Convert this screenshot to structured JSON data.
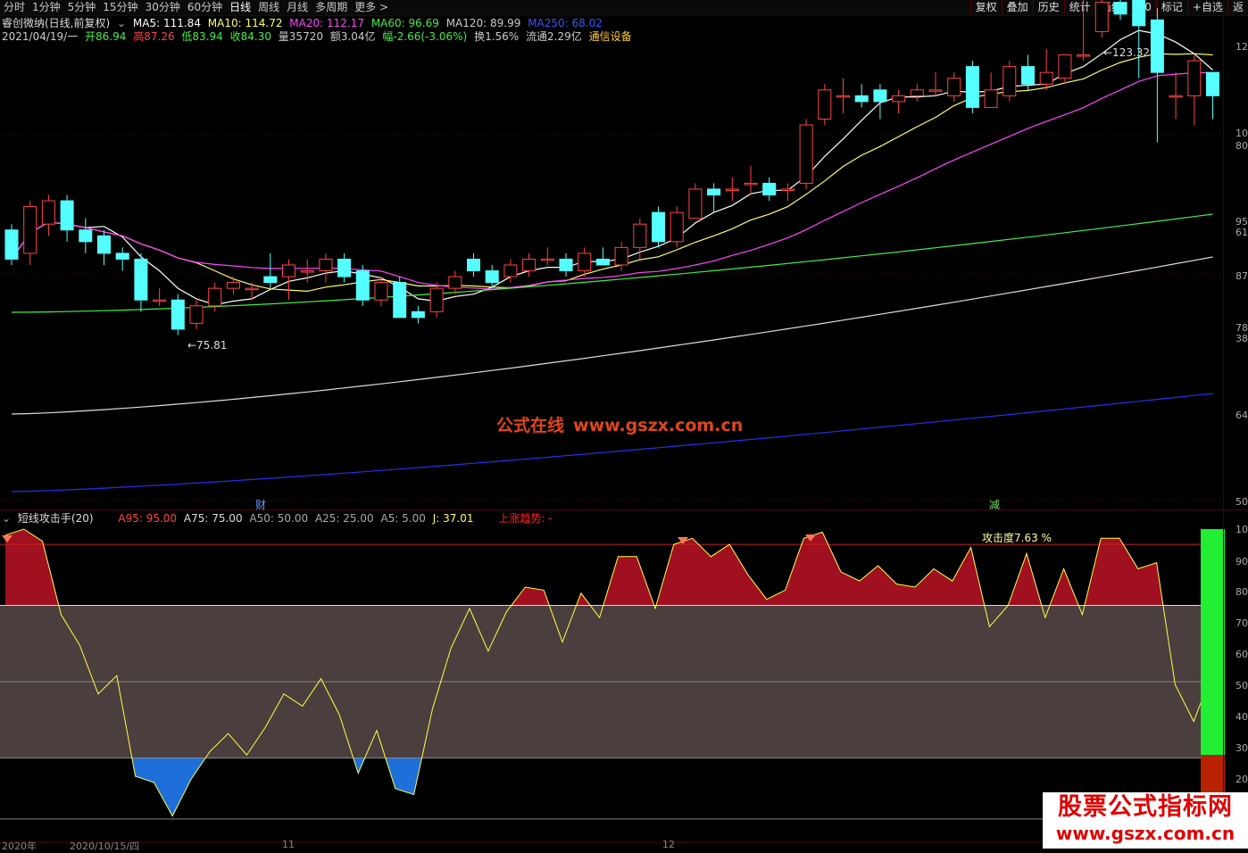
{
  "toolbar": {
    "periods": [
      "分时",
      "1分钟",
      "5分钟",
      "15分钟",
      "30分钟",
      "60分钟",
      "日线",
      "周线",
      "月线",
      "多周期",
      "更多 >"
    ],
    "right": [
      "复权",
      "叠加",
      "历史",
      "统计",
      "画线",
      "F10",
      "标记",
      "+自选",
      "返"
    ]
  },
  "ma_row": {
    "stock": "睿创微纳(日线,前复权)",
    "items": [
      {
        "text": "MA5: 111.84",
        "color": "#ffffff"
      },
      {
        "text": "MA10: 114.72",
        "color": "#ffff66"
      },
      {
        "text": "MA20: 112.17",
        "color": "#ff44ff"
      },
      {
        "text": "MA60: 96.69",
        "color": "#44ee44"
      },
      {
        "text": "MA120: 89.99",
        "color": "#cccccc"
      },
      {
        "text": "MA250: 68.02",
        "color": "#3355ff"
      }
    ]
  },
  "quote_row": {
    "items": [
      {
        "text": "2021/04/19/一",
        "color": "#cccccc"
      },
      {
        "text": "开86.94",
        "color": "#44ee44"
      },
      {
        "text": "高87.26",
        "color": "#ff4444"
      },
      {
        "text": "低83.94",
        "color": "#44ee44"
      },
      {
        "text": "收84.30",
        "color": "#44ee44"
      },
      {
        "text": "量35720",
        "color": "#cccccc"
      },
      {
        "text": "额3.04亿",
        "color": "#cccccc"
      },
      {
        "text": "幅-2.66(-3.06%)",
        "color": "#44ee44"
      },
      {
        "text": "换1.56%",
        "color": "#cccccc"
      },
      {
        "text": "流通2.29亿",
        "color": "#cccccc"
      },
      {
        "text": "通信设备",
        "color": "#ffcc33"
      }
    ]
  },
  "price_chart": {
    "high_label": "←123.32",
    "low_label": "←75.81",
    "markers": [
      "财",
      "减"
    ],
    "right_ticks": [
      "12",
      "10",
      "80",
      "95",
      "61",
      "87",
      "78",
      "38",
      "64",
      "50"
    ],
    "candles": [
      {
        "o": 94,
        "c": 89,
        "h": 95,
        "l": 88
      },
      {
        "o": 90,
        "c": 98,
        "h": 99,
        "l": 88
      },
      {
        "o": 95,
        "c": 99,
        "h": 100,
        "l": 93
      },
      {
        "o": 99,
        "c": 94,
        "h": 100,
        "l": 92
      },
      {
        "o": 94,
        "c": 92,
        "h": 96,
        "l": 90
      },
      {
        "o": 93,
        "c": 90,
        "h": 94,
        "l": 88
      },
      {
        "o": 90,
        "c": 89,
        "h": 91,
        "l": 87
      },
      {
        "o": 89,
        "c": 82,
        "h": 90,
        "l": 80
      },
      {
        "o": 82,
        "c": 82,
        "h": 84,
        "l": 81
      },
      {
        "o": 82,
        "c": 77,
        "h": 83,
        "l": 76
      },
      {
        "o": 78,
        "c": 81,
        "h": 82,
        "l": 77
      },
      {
        "o": 81,
        "c": 84,
        "h": 85,
        "l": 80
      },
      {
        "o": 84,
        "c": 85,
        "h": 86,
        "l": 83
      },
      {
        "o": 84,
        "c": 84,
        "h": 85,
        "l": 82
      },
      {
        "o": 86,
        "c": 85,
        "h": 90,
        "l": 84
      },
      {
        "o": 86,
        "c": 88,
        "h": 89,
        "l": 82
      },
      {
        "o": 87,
        "c": 87,
        "h": 89,
        "l": 85
      },
      {
        "o": 87,
        "c": 89,
        "h": 90,
        "l": 85
      },
      {
        "o": 89,
        "c": 86,
        "h": 90,
        "l": 85
      },
      {
        "o": 87,
        "c": 82,
        "h": 88,
        "l": 81
      },
      {
        "o": 82,
        "c": 85,
        "h": 86,
        "l": 81
      },
      {
        "o": 85,
        "c": 79,
        "h": 86,
        "l": 79
      },
      {
        "o": 80,
        "c": 79,
        "h": 81,
        "l": 78
      },
      {
        "o": 80,
        "c": 84,
        "h": 85,
        "l": 79
      },
      {
        "o": 84,
        "c": 86,
        "h": 87,
        "l": 83
      },
      {
        "o": 89,
        "c": 87,
        "h": 90,
        "l": 86
      },
      {
        "o": 87,
        "c": 85,
        "h": 88,
        "l": 84
      },
      {
        "o": 86,
        "c": 88,
        "h": 89,
        "l": 85
      },
      {
        "o": 87,
        "c": 89,
        "h": 90,
        "l": 86
      },
      {
        "o": 89,
        "c": 89,
        "h": 91,
        "l": 88
      },
      {
        "o": 89,
        "c": 87,
        "h": 90,
        "l": 86
      },
      {
        "o": 87,
        "c": 90,
        "h": 91,
        "l": 86
      },
      {
        "o": 89,
        "c": 88,
        "h": 91,
        "l": 88
      },
      {
        "o": 88,
        "c": 91,
        "h": 92,
        "l": 87
      },
      {
        "o": 91,
        "c": 95,
        "h": 96,
        "l": 89
      },
      {
        "o": 97,
        "c": 92,
        "h": 98,
        "l": 91
      },
      {
        "o": 92,
        "c": 97,
        "h": 98,
        "l": 91
      },
      {
        "o": 96,
        "c": 101,
        "h": 102,
        "l": 96
      },
      {
        "o": 101,
        "c": 100,
        "h": 102,
        "l": 97
      },
      {
        "o": 101,
        "c": 101,
        "h": 103,
        "l": 99
      },
      {
        "o": 102,
        "c": 102,
        "h": 105,
        "l": 100
      },
      {
        "o": 102,
        "c": 100,
        "h": 103,
        "l": 99
      },
      {
        "o": 101,
        "c": 101,
        "h": 102,
        "l": 99
      },
      {
        "o": 102,
        "c": 112,
        "h": 113,
        "l": 101
      },
      {
        "o": 113,
        "c": 118,
        "h": 119,
        "l": 112
      },
      {
        "o": 117,
        "c": 117,
        "h": 120,
        "l": 114
      },
      {
        "o": 117,
        "c": 116,
        "h": 119,
        "l": 115
      },
      {
        "o": 118,
        "c": 116,
        "h": 119,
        "l": 113
      },
      {
        "o": 116,
        "c": 117,
        "h": 118,
        "l": 114
      },
      {
        "o": 117,
        "c": 118,
        "h": 119,
        "l": 116
      },
      {
        "o": 118,
        "c": 118,
        "h": 121,
        "l": 117
      },
      {
        "o": 117,
        "c": 120,
        "h": 121,
        "l": 116
      },
      {
        "o": 122,
        "c": 115,
        "h": 123,
        "l": 114
      },
      {
        "o": 115,
        "c": 118,
        "h": 121,
        "l": 116
      },
      {
        "o": 117,
        "c": 122,
        "h": 123,
        "l": 116
      },
      {
        "o": 122,
        "c": 119,
        "h": 124,
        "l": 118
      },
      {
        "o": 119,
        "c": 121,
        "h": 125,
        "l": 118
      },
      {
        "o": 120,
        "c": 124,
        "h": 124,
        "l": 119
      },
      {
        "o": 124,
        "c": 124,
        "h": 135,
        "l": 123
      },
      {
        "o": 128,
        "c": 133,
        "h": 134,
        "l": 127
      },
      {
        "o": 133,
        "c": 131,
        "h": 136,
        "l": 130
      },
      {
        "o": 134,
        "c": 129,
        "h": 134,
        "l": 120
      },
      {
        "o": 130,
        "c": 121,
        "h": 132,
        "l": 109
      },
      {
        "o": 117,
        "c": 117,
        "h": 121,
        "l": 113
      },
      {
        "o": 117,
        "c": 123,
        "h": 124,
        "l": 112
      },
      {
        "o": 121,
        "c": 117,
        "h": 121,
        "l": 113
      }
    ]
  },
  "indicator": {
    "name": "短线攻击手(20)",
    "values": [
      {
        "text": "A95: 95.00",
        "color": "#ff4444"
      },
      {
        "text": "A75: 75.00",
        "color": "#dddddd"
      },
      {
        "text": "A50: 50.00",
        "color": "#aaaaaa"
      },
      {
        "text": "A25: 25.00",
        "color": "#aaaaaa"
      },
      {
        "text": "A5: 5.00",
        "color": "#aaaaaa"
      },
      {
        "text": "J: 37.01",
        "color": "#ffff66"
      },
      {
        "text": "上涨趋势: -",
        "color": "#ff2222"
      }
    ],
    "attack_label": "攻击度7.63 %",
    "levels": [
      95,
      75,
      50,
      25,
      5
    ],
    "right_ticks": [
      "10",
      "90",
      "80",
      "70",
      "60",
      "50",
      "40",
      "30",
      "20"
    ],
    "j": [
      98,
      100,
      96,
      72,
      62,
      46,
      52,
      19,
      17,
      6,
      18,
      27,
      33,
      26,
      35,
      46,
      42,
      51,
      39,
      20,
      34,
      15,
      13,
      41,
      61,
      74,
      60,
      73,
      81,
      80,
      63,
      79,
      71,
      91,
      91,
      74,
      95,
      97,
      91,
      95,
      85,
      77,
      80,
      97,
      99,
      86,
      83,
      88,
      82,
      81,
      87,
      83,
      94,
      68,
      75,
      92,
      71,
      87,
      72,
      97,
      97,
      87,
      89,
      49,
      37,
      53
    ],
    "bar_value": 26
  },
  "watermark": {
    "text1": "公式在线",
    "text2": "www.gszx.com.cn"
  },
  "brand": {
    "line1": "股票公式指标网",
    "line2": "www.gszx.com.cn"
  },
  "dates": [
    "2020年",
    "2020/10/15/四",
    "11",
    "12"
  ]
}
